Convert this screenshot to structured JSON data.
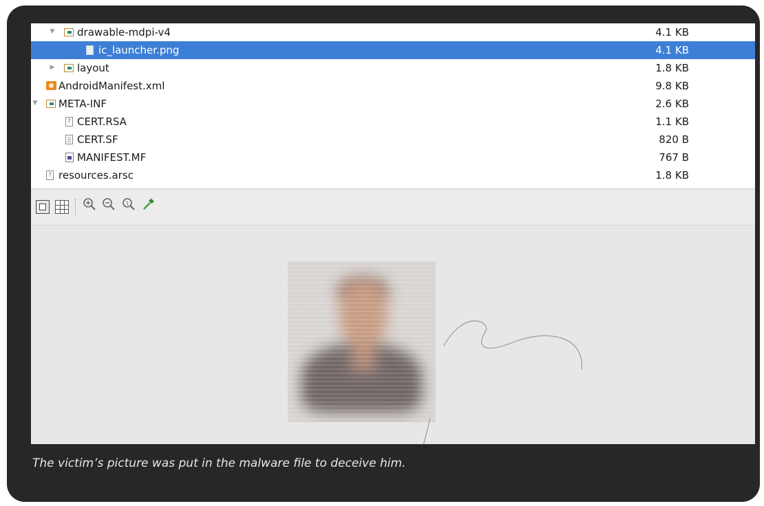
{
  "tree": {
    "rows": [
      {
        "name": "drawable-mdpi-v4",
        "size": "4.1 KB",
        "icon": "folder-icon",
        "arrow": "▼",
        "selected": false
      },
      {
        "name": "ic_launcher.png",
        "size": "4.1 KB",
        "icon": "png-file-icon",
        "arrow": "",
        "selected": true
      },
      {
        "name": "layout",
        "size": "1.8 KB",
        "icon": "folder-icon",
        "arrow": "▶",
        "selected": false
      },
      {
        "name": "AndroidManifest.xml",
        "size": "9.8 KB",
        "icon": "xml-file-icon",
        "arrow": "",
        "selected": false
      },
      {
        "name": "META-INF",
        "size": "2.6 KB",
        "icon": "folder-icon",
        "arrow": "▼",
        "selected": false
      },
      {
        "name": "CERT.RSA",
        "size": "1.1 KB",
        "icon": "unknown-file-icon",
        "arrow": "",
        "selected": false
      },
      {
        "name": "CERT.SF",
        "size": "820 B",
        "icon": "text-file-icon",
        "arrow": "",
        "selected": false
      },
      {
        "name": "MANIFEST.MF",
        "size": "767 B",
        "icon": "manifest-file-icon",
        "arrow": "",
        "selected": false
      },
      {
        "name": "resources.arsc",
        "size": "1.8 KB",
        "icon": "unknown-file-icon",
        "arrow": "",
        "selected": false
      }
    ]
  },
  "toolbar": {
    "zoom_in_icon": "zoom-in-icon",
    "zoom_out_icon": "zoom-out-icon",
    "actual_size_icon": "actual-size-icon",
    "color_picker_icon": "eyedropper-icon"
  },
  "colors": {
    "selection": "#3d7fd6",
    "frame": "#272727",
    "canvas": "#e7e7e7"
  },
  "caption": "The victim’s picture was put in the malware file to deceive him."
}
